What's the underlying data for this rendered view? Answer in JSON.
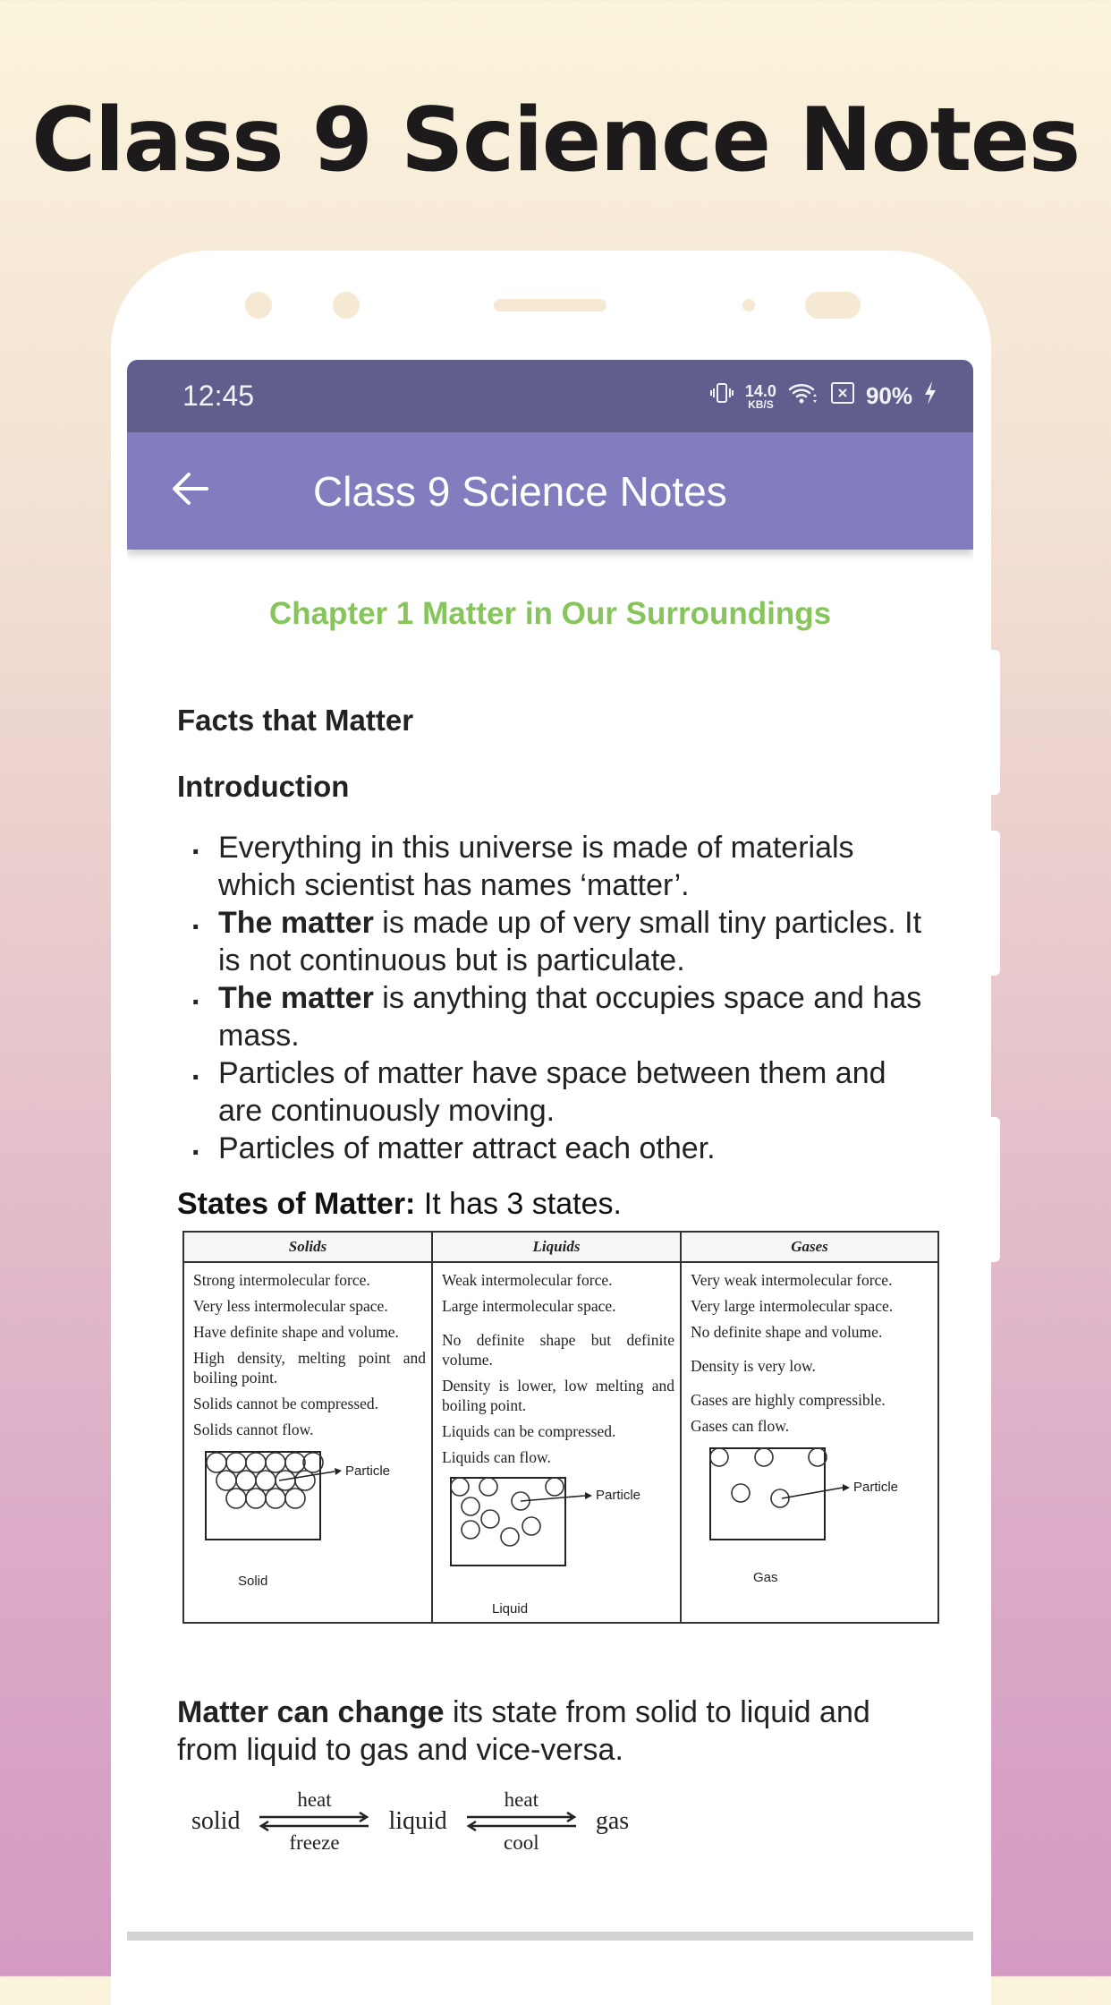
{
  "promo": {
    "title": "Class 9 Science Notes"
  },
  "status_bar": {
    "time": "12:45",
    "network_speed_value": "14.0",
    "network_speed_unit": "KB/S",
    "battery": "90%",
    "icons": [
      "vibrate-icon",
      "network-speed",
      "wifi-icon",
      "no-sim-icon",
      "battery-text",
      "charging-icon"
    ]
  },
  "app_bar": {
    "title": "Class 9 Science Notes",
    "back_icon": "arrow-left-icon"
  },
  "content": {
    "chapter_title": "Chapter 1 Matter in Our Surroundings",
    "heading_facts": "Facts that Matter",
    "heading_intro": "Introduction",
    "bullets": [
      {
        "bold": "",
        "text": "Everything in this universe is made of materials which scientist has names ‘matter’."
      },
      {
        "bold": "The matter",
        "text": " is made up of very small tiny particles. It is not continuous but is particulate."
      },
      {
        "bold": "The matter",
        "text": " is anything that occupies space and has mass."
      },
      {
        "bold": "",
        "text": "Particles of matter have space between them and are continuously moving."
      },
      {
        "bold": "",
        "text": "Particles of matter attract each other."
      }
    ],
    "states_bold": "States of Matter:",
    "states_text": " It has 3 states.",
    "table": {
      "headers": [
        "Solids",
        "Liquids",
        "Gases"
      ],
      "columns": [
        [
          "Strong intermolecular force.",
          "Very less intermolecular space.",
          "Have definite shape and volume.",
          "High density, melting point and boiling point.",
          "Solids cannot be compressed.",
          "Solids cannot flow."
        ],
        [
          "Weak intermolecular force.",
          "Large intermolecular space.",
          "No definite shape but definite volume.",
          "Density is lower, low melting and boiling point.",
          "Liquids can be compressed.",
          "Liquids can flow."
        ],
        [
          "Very weak intermolecular force.",
          "Very large intermolecular space.",
          "No definite shape and volume.",
          "Density is very low.",
          "Gases are highly compressible.",
          "Gases can flow."
        ]
      ],
      "diagram_labels": [
        "Solid",
        "Liquid",
        "Gas"
      ],
      "particle_label": "Particle"
    },
    "change_bold": "Matter can change",
    "change_text": " its state from solid to liquid and from liquid to gas and vice-versa.",
    "equation": {
      "solid": "solid",
      "liquid": "liquid",
      "gas": "gas",
      "arrow1_top": "heat",
      "arrow1_bottom": "freeze",
      "arrow2_top": "heat",
      "arrow2_bottom": "cool"
    }
  },
  "colors": {
    "status_bar": "#5f5e8d",
    "app_bar": "#817dbe",
    "chapter_title": "#86c55a"
  }
}
